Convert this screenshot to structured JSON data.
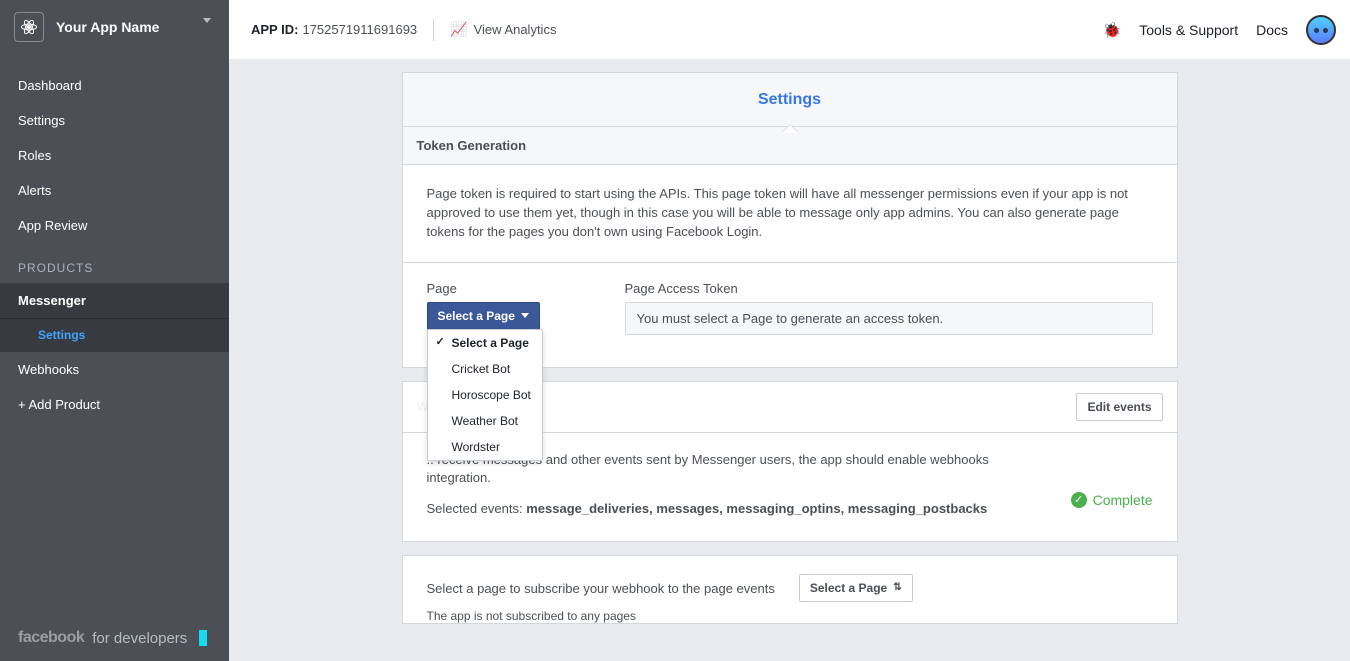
{
  "sidebar": {
    "app_name": "Your App Name",
    "items": [
      "Dashboard",
      "Settings",
      "Roles",
      "Alerts",
      "App Review"
    ],
    "products_header": "PRODUCTS",
    "messenger": {
      "label": "Messenger",
      "child": "Settings"
    },
    "webhooks": "Webhooks",
    "add_product": "+ Add Product",
    "brand_a": "facebook",
    "brand_b": "for developers"
  },
  "topbar": {
    "app_id_label": "APP ID:",
    "app_id_value": "1752571911691693",
    "analytics": "View Analytics",
    "tools": "Tools & Support",
    "docs": "Docs"
  },
  "tabs": {
    "active": "Settings"
  },
  "token": {
    "header": "Token Generation",
    "desc": "Page token is required to start using the APIs. This page token will have all messenger permissions even if your app is not approved to use them yet, though in this case you will be able to message only app admins. You can also generate page tokens for the pages you don't own using Facebook Login.",
    "page_label": "Page",
    "access_label": "Page Access Token",
    "select_btn": "Select a Page",
    "token_placeholder": "You must select a Page to generate an access token.",
    "dropdown": [
      "Select a Page",
      "Cricket Bot",
      "Horoscope Bot",
      "Weather Bot",
      "Wordster"
    ]
  },
  "wh": {
    "header_hidden": "W",
    "edit_btn": "Edit events",
    "desc1": ".. receive messages and other events sent by Messenger users, the app should enable webhooks integration.",
    "sel_label": "Selected events: ",
    "events": "message_deliveries, messages, messaging_optins, messaging_postbacks",
    "status": "Complete"
  },
  "sub": {
    "text": "Select a page to subscribe your webhook to the page events",
    "select_btn": "Select a Page",
    "note": "The app is not subscribed to any pages"
  }
}
